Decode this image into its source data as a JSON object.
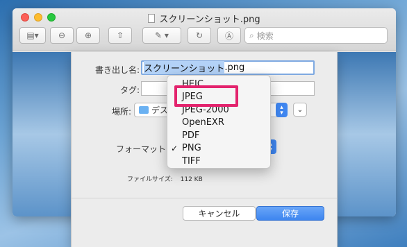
{
  "window": {
    "title": "スクリーンショット.png"
  },
  "toolbar": {
    "search_placeholder": "検索"
  },
  "dialog": {
    "name_label": "書き出し名:",
    "name_selected": "スクリーンショット",
    "name_extension": ".png",
    "tag_label": "タグ:",
    "location_label": "場所:",
    "location_value": "デス",
    "format_label": "フォーマット",
    "filesize_label": "ファイルサイズ:",
    "filesize_value": "112 KB",
    "cancel_label": "キャンセル",
    "save_label": "保存"
  },
  "format_menu": {
    "items": [
      "HEIC",
      "JPEG",
      "JPEG-2000",
      "OpenEXR",
      "PDF",
      "PNG",
      "TIFF"
    ],
    "checked": "PNG",
    "highlighted": "JPEG"
  },
  "colors": {
    "highlight_border": "#e3236d",
    "accent": "#3f86f0"
  }
}
